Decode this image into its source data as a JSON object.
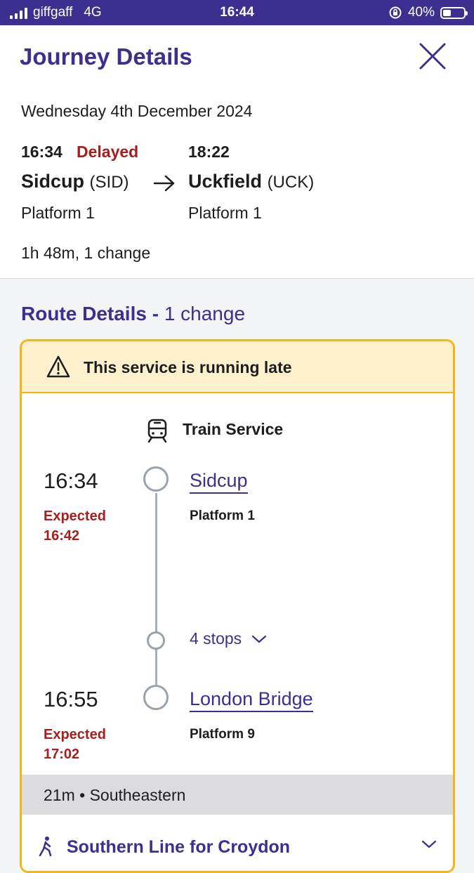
{
  "status_bar": {
    "carrier": "giffgaff",
    "network": "4G",
    "time": "16:44",
    "battery": "40%",
    "battery_level": 0.4
  },
  "header": {
    "title": "Journey Details",
    "close_icon": "close-icon"
  },
  "journey": {
    "date": "Wednesday 4th December 2024",
    "departure": {
      "time": "16:34",
      "status": "Delayed",
      "station": "Sidcup",
      "code": "(SID)",
      "platform": "Platform 1"
    },
    "arrival": {
      "time": "18:22",
      "station": "Uckfield",
      "code": "(UCK)",
      "platform": "Platform 1"
    },
    "summary": "1h 48m, 1 change"
  },
  "route": {
    "title": "Route Details -",
    "changes": "1 change",
    "alert": "This service is running late",
    "service_label": "Train Service",
    "stops": [
      {
        "time": "16:34",
        "expected": "Expected 16:42",
        "name": "Sidcup",
        "platform": "Platform 1"
      },
      {
        "time": "16:55",
        "expected": "Expected 17:02",
        "name": "London Bridge",
        "platform": "Platform 9"
      }
    ],
    "intermediate": "4 stops",
    "leg_info": "21m • Southeastern",
    "next_leg": "Southern Line for Croydon"
  },
  "colors": {
    "brand": "#3d2f8f",
    "delayed": "#a51f1f",
    "alert_border": "#f2b51c",
    "alert_bg": "#fdf0cc"
  }
}
